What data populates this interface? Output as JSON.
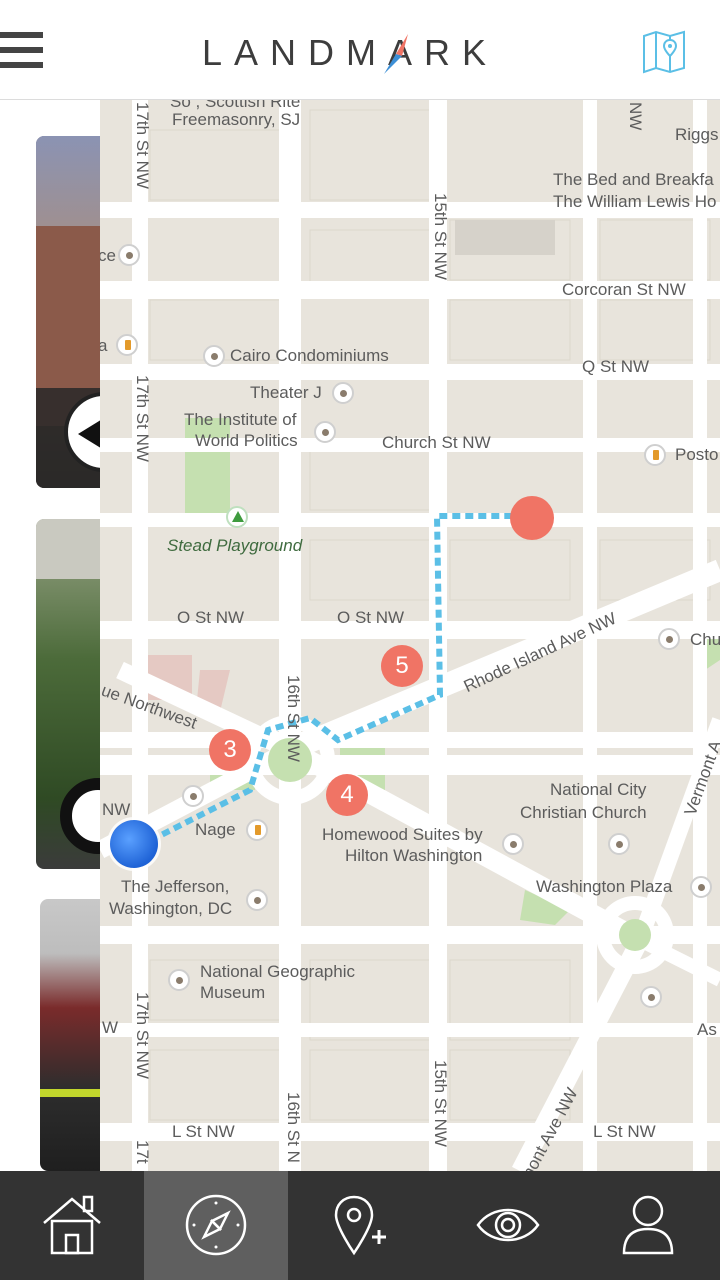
{
  "header": {
    "logo_text": "LANDMARK",
    "menu_icon": "hamburger-icon",
    "map_icon": "map-pin-icon"
  },
  "map": {
    "labels": {
      "freemasonry": "Freemasonry, SJ",
      "scottish_rite": "So , Scottish Rite",
      "riggs": "Riggs",
      "bed_breakfast_1": "The Bed and Breakfa",
      "bed_breakfast_2": "The William Lewis Ho",
      "corcoran": "Corcoran St NW",
      "q_st": "Q St NW",
      "cairo": "Cairo Condominiums",
      "theater_j": "Theater J",
      "institute_1": "The Institute of",
      "institute_2": "World Politics",
      "church_st": "Church St NW",
      "posto": "Posto",
      "stead": "Stead Playground",
      "o_st_left": "O St NW",
      "o_st_right": "O St NW",
      "rhode_island": "Rhode Island Ave NW",
      "chu": "Chu",
      "ue_northwest": "ue Northwest",
      "national_city_1": "National City",
      "national_city_2": "Christian Church",
      "vermont": "Vermont A",
      "nw": "NW",
      "nage": "Nage",
      "homewood_1": "Homewood Suites by",
      "homewood_2": "Hilton Washington",
      "jefferson_1": "The Jefferson,",
      "jefferson_2": "Washington, DC",
      "washington_plaza": "Washington Plaza",
      "natgeo_1": "National Geographic",
      "natgeo_2": "Museum",
      "w": "W",
      "as": "As",
      "l_st_left": "L St NW",
      "l_st_right": "L St NW",
      "vermont_ave": "mont Ave NW",
      "st17": "17th St NW",
      "st17_b": "17th St NW",
      "st17_c": "17th St NW",
      "st17_d": "17t",
      "st15": "15th St NW",
      "st15_b": "15th St NW",
      "st16": "16th St NW",
      "st16_b": "16th St N",
      "ce": "ce",
      "a": "a",
      "nw_top": "NW"
    },
    "markers": [
      "3",
      "4",
      "5"
    ]
  },
  "nav": {
    "items": [
      {
        "icon": "home-icon"
      },
      {
        "icon": "compass-icon"
      },
      {
        "icon": "add-location-icon"
      },
      {
        "icon": "eye-icon"
      },
      {
        "icon": "profile-icon"
      }
    ],
    "active_index": 1
  },
  "colors": {
    "accent_red": "#f07465",
    "route_blue": "#5bbfe6",
    "nav_bg": "#333333"
  }
}
